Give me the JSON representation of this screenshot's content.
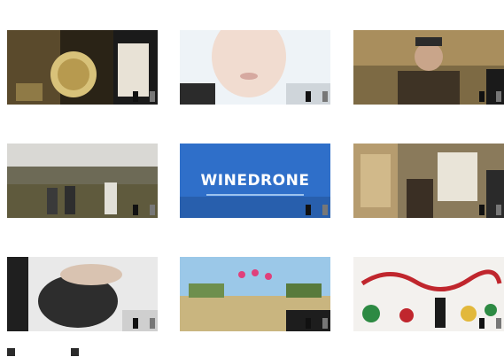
{
  "rows": [
    {
      "captions": [
        "",
        "",
        ""
      ]
    },
    {
      "captions": [
        "",
        "",
        ""
      ]
    },
    {
      "captions": [
        "",
        "",
        ""
      ]
    }
  ],
  "videos": [
    {
      "badge_a": "",
      "badge_b": ""
    },
    {
      "badge_a": "",
      "badge_b": ""
    },
    {
      "badge_a": "",
      "badge_b": ""
    },
    {
      "badge_a": "",
      "badge_b": ""
    },
    {
      "badge_a": "",
      "badge_b": "",
      "title": "WINEDRONE"
    },
    {
      "badge_a": "",
      "badge_b": ""
    },
    {
      "badge_a": "",
      "badge_b": ""
    },
    {
      "badge_a": "",
      "badge_b": ""
    },
    {
      "badge_a": "",
      "badge_b": ""
    }
  ],
  "footer": {
    "col1": "",
    "col2": "",
    "col3": "",
    "chip1": "",
    "chip2": ""
  },
  "colors": {
    "badge_dark": "#111111",
    "badge_light": "#777777",
    "drone_blue": "#2f6fc9"
  }
}
